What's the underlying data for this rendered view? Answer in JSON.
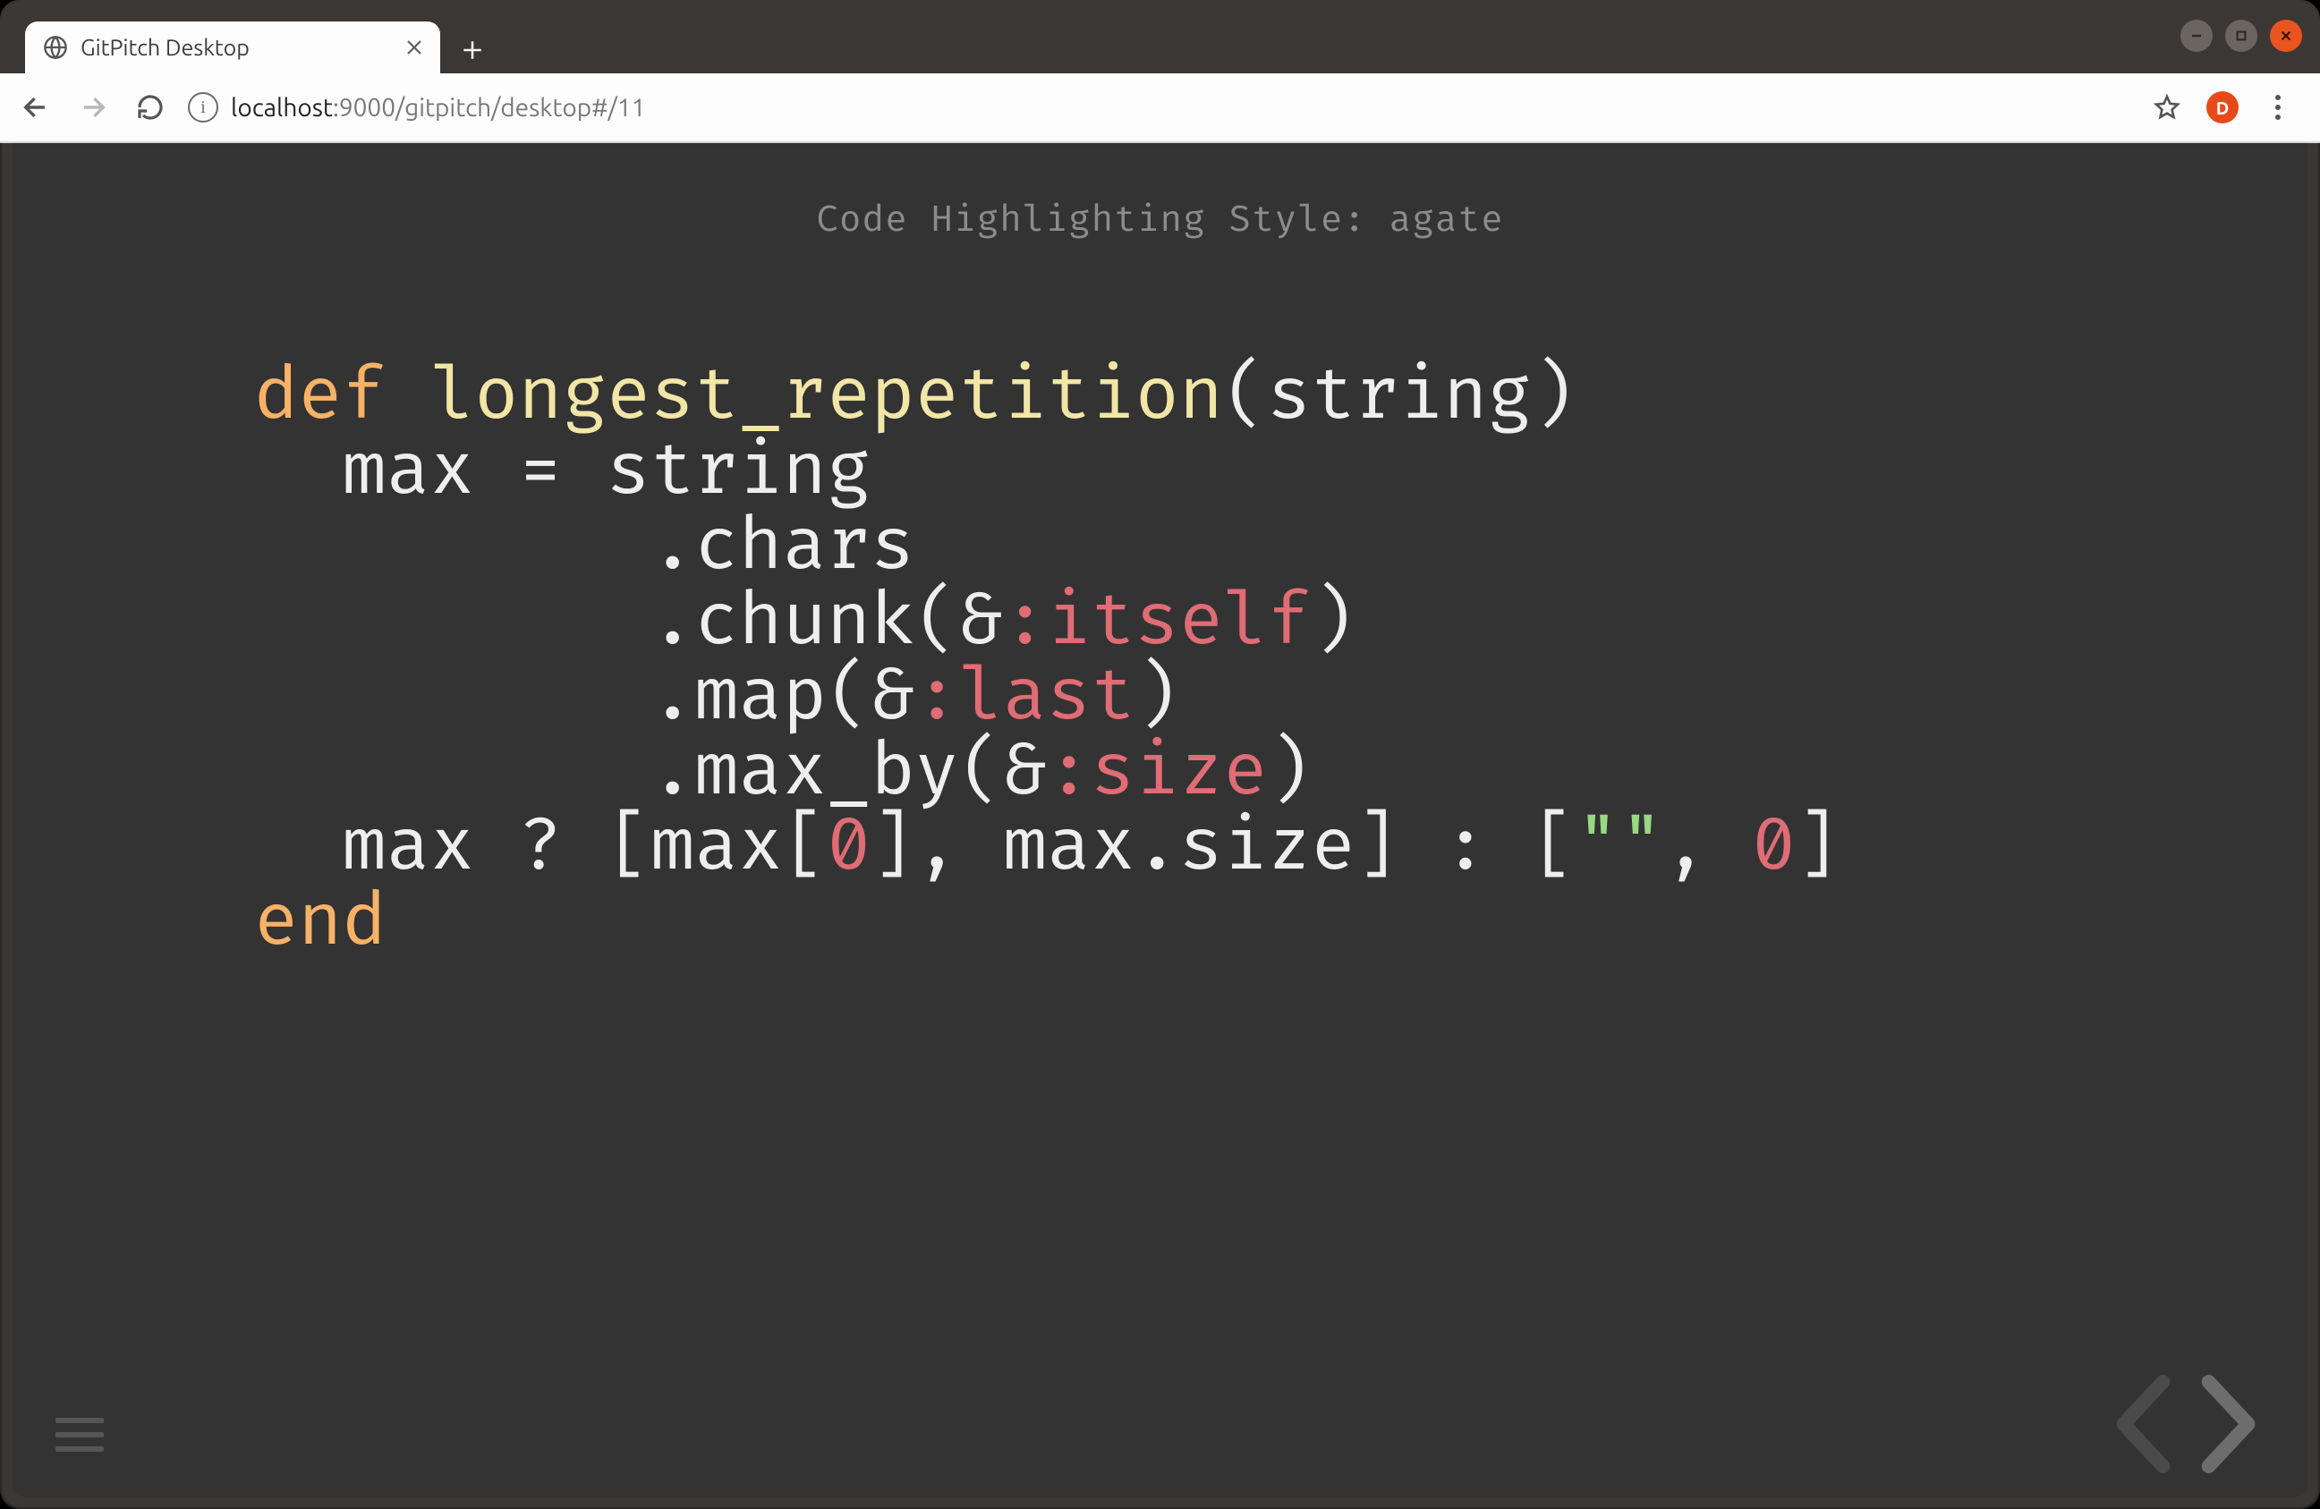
{
  "window": {
    "tab_title": "GitPitch Desktop",
    "window_controls": {
      "min": "–",
      "max": "▢",
      "close": "✕"
    }
  },
  "address": {
    "info_char": "i",
    "host_dim": "localhost",
    "host_port": ":9000",
    "path": "/gitpitch/desktop#/11",
    "avatar_initial": "D"
  },
  "slide": {
    "title": "Code Highlighting Style: agate"
  },
  "code": {
    "l1_def": "def",
    "l1_fn": "longest_repetition",
    "l1_args": "(string)",
    "l2": "  max = string",
    "l3": "         .chars",
    "l4_pre": "         .chunk(&",
    "l4_sym": ":itself",
    "l4_post": ")",
    "l5_pre": "         .map(&",
    "l5_sym": ":last",
    "l5_post": ")",
    "l6_pre": "         .max_by(&",
    "l6_sym": ":size",
    "l6_post": ")",
    "l7_a": "  max ? [max[",
    "l7_zero1": "0",
    "l7_b": "], max.size] : [",
    "l7_str": "\"\"",
    "l7_c": ", ",
    "l7_zero2": "0",
    "l7_d": "]",
    "l8_end": "end"
  }
}
